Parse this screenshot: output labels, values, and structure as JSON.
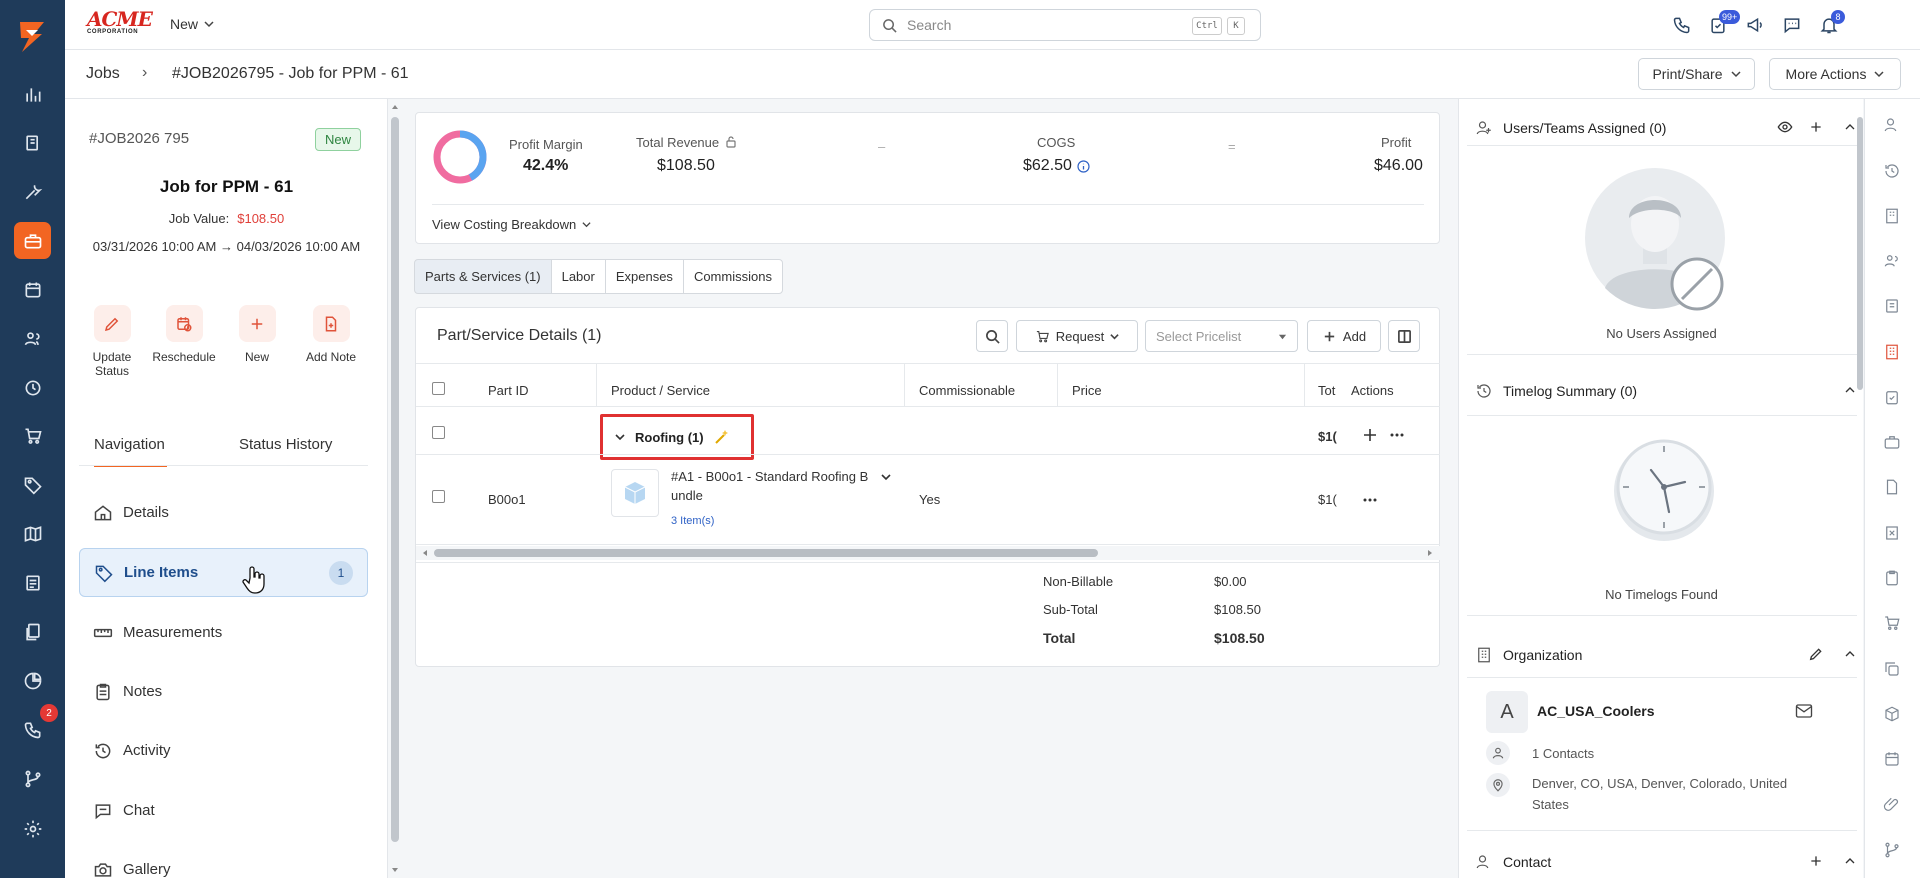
{
  "header": {
    "brand_line1": "ACME",
    "brand_line2": "CORPORATION",
    "new_label": "New",
    "search_placeholder": "Search",
    "kbd1": "Ctrl",
    "kbd2": "K",
    "badge_messages": "99+",
    "badge_notifications": "8"
  },
  "rail": {
    "badge_phone": "2"
  },
  "breadcrumb": {
    "root": "Jobs",
    "separator": "›",
    "current": "#JOB2026795 - Job for PPM - 61"
  },
  "actions": {
    "print_share": "Print/Share",
    "more_actions": "More Actions"
  },
  "job": {
    "number": "#JOB2026 795",
    "status": "New",
    "title": "Job for PPM - 61",
    "value_label": "Job Value:",
    "value": "$108.50",
    "dates": "03/31/2026 10:00 AM → 04/03/2026 10:00 AM"
  },
  "quick_actions": [
    {
      "label": "Update Status"
    },
    {
      "label": "Reschedule"
    },
    {
      "label": "New"
    },
    {
      "label": "Add Note"
    }
  ],
  "left_tabs": {
    "navigation": "Navigation",
    "status_history": "Status History"
  },
  "nav": [
    {
      "label": "Details"
    },
    {
      "label": "Line Items",
      "count": "1"
    },
    {
      "label": "Measurements"
    },
    {
      "label": "Notes"
    },
    {
      "label": "Activity"
    },
    {
      "label": "Chat"
    },
    {
      "label": "Gallery"
    }
  ],
  "summary": {
    "profit_margin_label": "Profit Margin",
    "profit_margin": "42.4%",
    "total_revenue_label": "Total Revenue",
    "total_revenue": "$108.50",
    "minus": "–",
    "cogs_label": "COGS",
    "cogs": "$62.50",
    "equals": "=",
    "profit_label": "Profit",
    "profit": "$46.00",
    "costing_link": "View Costing Breakdown",
    "margin_fraction": 0.424
  },
  "center_tabs": [
    "Parts & Services (1)",
    "Labor",
    "Expenses",
    "Commissions"
  ],
  "details": {
    "title": "Part/Service Details (1)",
    "request_label": "Request",
    "pricelist_placeholder": "Select Pricelist",
    "add_label": "Add",
    "columns": {
      "part_id": "Part ID",
      "product": "Product / Service",
      "commissionable": "Commissionable",
      "price": "Price",
      "total": "Tot",
      "actions": "Actions"
    },
    "group": {
      "label": "Roofing (1)",
      "total": "$1("
    },
    "row": {
      "part_id": "B00o1",
      "product_line1": "#A1 - B00o1 - Standard Roofing B",
      "product_line2": "undle",
      "items": "3 Item(s)",
      "commissionable": "Yes",
      "total": "$1("
    },
    "totals": {
      "non_billable_label": "Non-Billable",
      "non_billable": "$0.00",
      "subtotal_label": "Sub-Total",
      "subtotal": "$108.50",
      "total_label": "Total",
      "total": "$108.50"
    }
  },
  "right": {
    "users_title": "Users/Teams Assigned (0)",
    "no_users": "No Users Assigned",
    "timelog_title": "Timelog Summary (0)",
    "no_timelogs": "No Timelogs Found",
    "org_title": "Organization",
    "org_initial": "A",
    "org_name": "AC_USA_Coolers",
    "contacts": "1 Contacts",
    "address_line1": "Denver, CO, USA, Denver, Colorado, United",
    "address_line2": "States",
    "contact_title": "Contact"
  },
  "colors": {
    "accent": "#f26522",
    "rail": "#1f3b5a",
    "highlight": "#e03131",
    "link": "#2f62c6"
  }
}
